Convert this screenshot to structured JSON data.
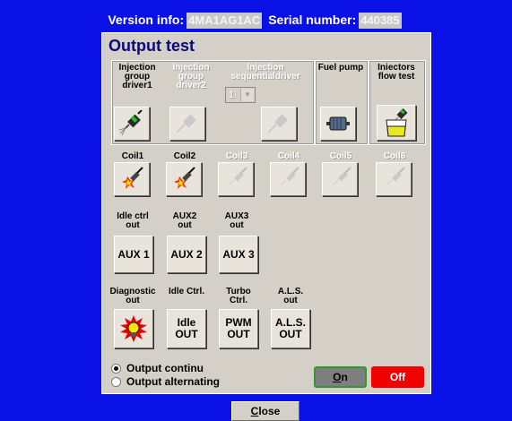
{
  "header": {
    "version_label": "Version info:",
    "version_value": "4MA1AG1AC",
    "serial_label": "Serial number:",
    "serial_value": "440385"
  },
  "panel": {
    "title": "Output test",
    "injection": [
      {
        "label": "Injection group driver1",
        "enabled": true
      },
      {
        "label": "Injection group driver2",
        "enabled": false
      },
      {
        "label": "Injection sequentialdriver",
        "enabled": false,
        "combo_value": "1"
      }
    ],
    "fuel_pump": "Fuel pump",
    "injectors_flow_test": "Iniectors flow test",
    "coils": [
      {
        "label": "Coil1",
        "enabled": true
      },
      {
        "label": "Coil2",
        "enabled": true
      },
      {
        "label": "Coil3",
        "enabled": false
      },
      {
        "label": "Coil4",
        "enabled": false
      },
      {
        "label": "Coil5",
        "enabled": false
      },
      {
        "label": "Coil6",
        "enabled": false
      }
    ],
    "aux": [
      {
        "label": "Idle ctrl out",
        "button": "AUX 1"
      },
      {
        "label": "AUX2 out",
        "button": "AUX 2"
      },
      {
        "label": "AUX3 out",
        "button": "AUX 3"
      }
    ],
    "misc": [
      {
        "label": "Diagnostic out",
        "button": ""
      },
      {
        "label": "Idle Ctrl.",
        "button": "Idle OUT"
      },
      {
        "label": "Turbo Ctrl.",
        "button": "PWM OUT"
      },
      {
        "label": "A.L.S. out",
        "button": "A.L.S. OUT"
      }
    ],
    "radio": [
      {
        "label": "Output continu",
        "selected": true
      },
      {
        "label": "Output alternating",
        "selected": false
      }
    ],
    "on_label_first": "O",
    "on_label_rest": "n",
    "off_label": "Off"
  },
  "close_first": "C",
  "close_rest": "lose"
}
